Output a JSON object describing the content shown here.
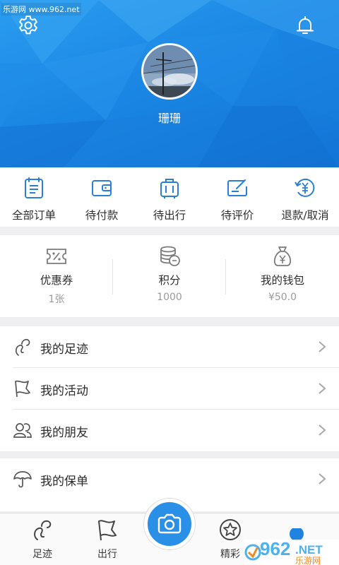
{
  "watermark": "乐游网 www.962.net",
  "profile": {
    "username": "珊珊"
  },
  "orders": [
    {
      "label": "全部订单",
      "icon": "all-orders-icon"
    },
    {
      "label": "待付款",
      "icon": "wallet-icon"
    },
    {
      "label": "待出行",
      "icon": "luggage-icon"
    },
    {
      "label": "待评价",
      "icon": "review-icon"
    },
    {
      "label": "退款/取消",
      "icon": "refund-icon"
    }
  ],
  "assets": [
    {
      "label": "优惠券",
      "value": "1张",
      "icon": "coupon-icon"
    },
    {
      "label": "积分",
      "value": "1000",
      "icon": "coins-icon"
    },
    {
      "label": "我的钱包",
      "value": "¥50.0",
      "icon": "money-bag-icon"
    }
  ],
  "menu": [
    {
      "label": "我的足迹",
      "icon": "footprint-icon"
    },
    {
      "label": "我的活动",
      "icon": "flag-icon"
    },
    {
      "label": "我的朋友",
      "icon": "friends-icon"
    }
  ],
  "menu2": [
    {
      "label": "我的保单",
      "icon": "umbrella-icon"
    }
  ],
  "tabbar": {
    "tabs": [
      {
        "label": "足迹",
        "icon": "footprint-icon"
      },
      {
        "label": "出行",
        "icon": "flag-icon"
      },
      {
        "label": "精彩",
        "icon": "star-icon"
      }
    ],
    "camera_icon": "camera-icon"
  },
  "corner_logo": {
    "number": "962",
    "suffix": ".NET",
    "name": "乐游网"
  },
  "colors": {
    "accent": "#1b87e4",
    "icon": "#2a7fd4"
  }
}
